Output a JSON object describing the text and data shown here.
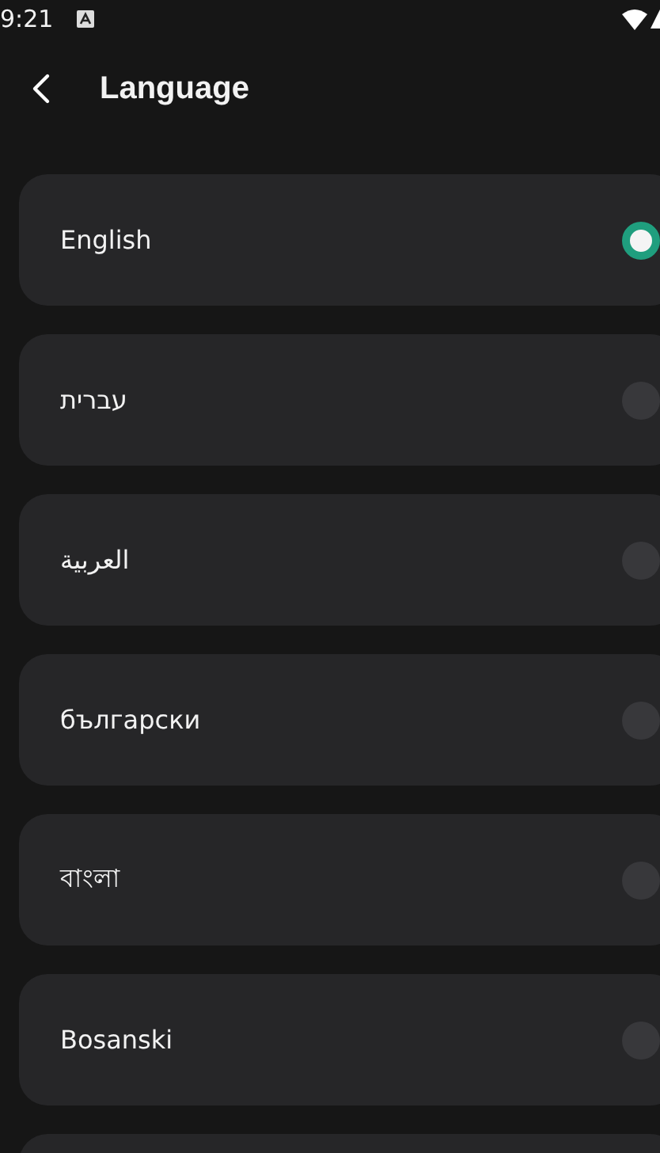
{
  "status_bar": {
    "time": "9:21"
  },
  "header": {
    "title": "Language"
  },
  "languages": [
    {
      "label": "English",
      "selected": true
    },
    {
      "label": "עברית",
      "selected": false
    },
    {
      "label": "العربية",
      "selected": false
    },
    {
      "label": "български",
      "selected": false
    },
    {
      "label": "বাংলা",
      "selected": false
    },
    {
      "label": "Bosanski",
      "selected": false
    }
  ]
}
